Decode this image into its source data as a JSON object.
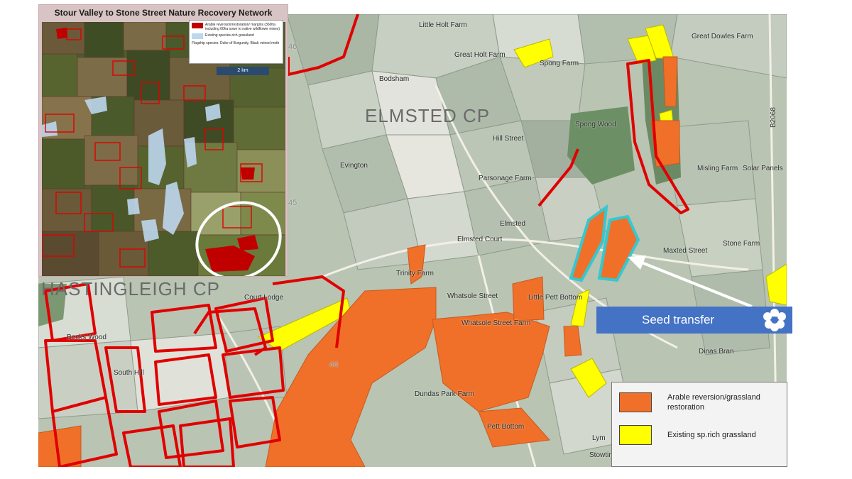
{
  "inset": {
    "title": "Stour Valley to Stone Street Nature Recovery Network",
    "legend": [
      {
        "label": "Arable reversion/restoration/ margins (360ha including 60ha sown to native wildflower mixes)",
        "color": "#c00000"
      },
      {
        "label": "Existing species-rich grassland",
        "color": "#bdd7ee"
      }
    ],
    "flagship_text": "Flagship species: Duke of Burgundy, Black veined moth",
    "scalebar": "2 km"
  },
  "map_labels": {
    "elmsted_cp": "ELMSTED CP",
    "hastingleigh_cp": "HASTINGLEIGH CP",
    "little_holt_farm": "Little Holt Farm",
    "great_holt_farm": "Great Holt Farm",
    "bodsham": "Bodsham",
    "spong_farm": "Spong Farm",
    "spong_wood": "Spong Wood",
    "great_dowles_farm": "Great Dowles Farm",
    "hill_street": "Hill Street",
    "evington": "Evington",
    "parsonage_farm": "Parsonage Farm",
    "elmsted": "Elmsted",
    "elmsted_court": "Elmsted Court",
    "misling_farm": "Misling Farm",
    "solar_panels": "Solar Panels",
    "maxted_street": "Maxted Street",
    "stone_farm": "Stone Farm",
    "trinity_farm": "Trinity Farm",
    "whatsole_street": "Whatsole Street",
    "little_pett_bottom": "Little Pett Bottom",
    "wheelbarrow_farm": "Whatsole Street Farm",
    "becks_wood": "Becks Wood",
    "south_hill": "South Hill",
    "dundas_park_farm": "Dundas Park Farm",
    "pett_bottom": "Pett Bottom",
    "court_lodge": "Court Lodge",
    "stowting": "Stowting",
    "dinas_bran": "Dinas Bran",
    "lym": "Lym",
    "grid_46": "46",
    "grid_45": "45",
    "grid_44": "44",
    "road_b2068": "B2068"
  },
  "seed_transfer": {
    "label": "Seed transfer",
    "banner_color": "#4472c4",
    "icon": "flower-icon"
  },
  "legend": {
    "items": [
      {
        "label": "Arable reversion/grassland restoration",
        "color": "#f07029"
      },
      {
        "label": "Existing sp.rich grassland",
        "color": "#ffff00"
      }
    ]
  },
  "colors": {
    "restoration_orange": "#f07029",
    "grassland_yellow": "#ffff00",
    "boundary_red": "#e00000",
    "highlight_cyan": "#35c8d0",
    "circle_white": "#ffffff"
  }
}
